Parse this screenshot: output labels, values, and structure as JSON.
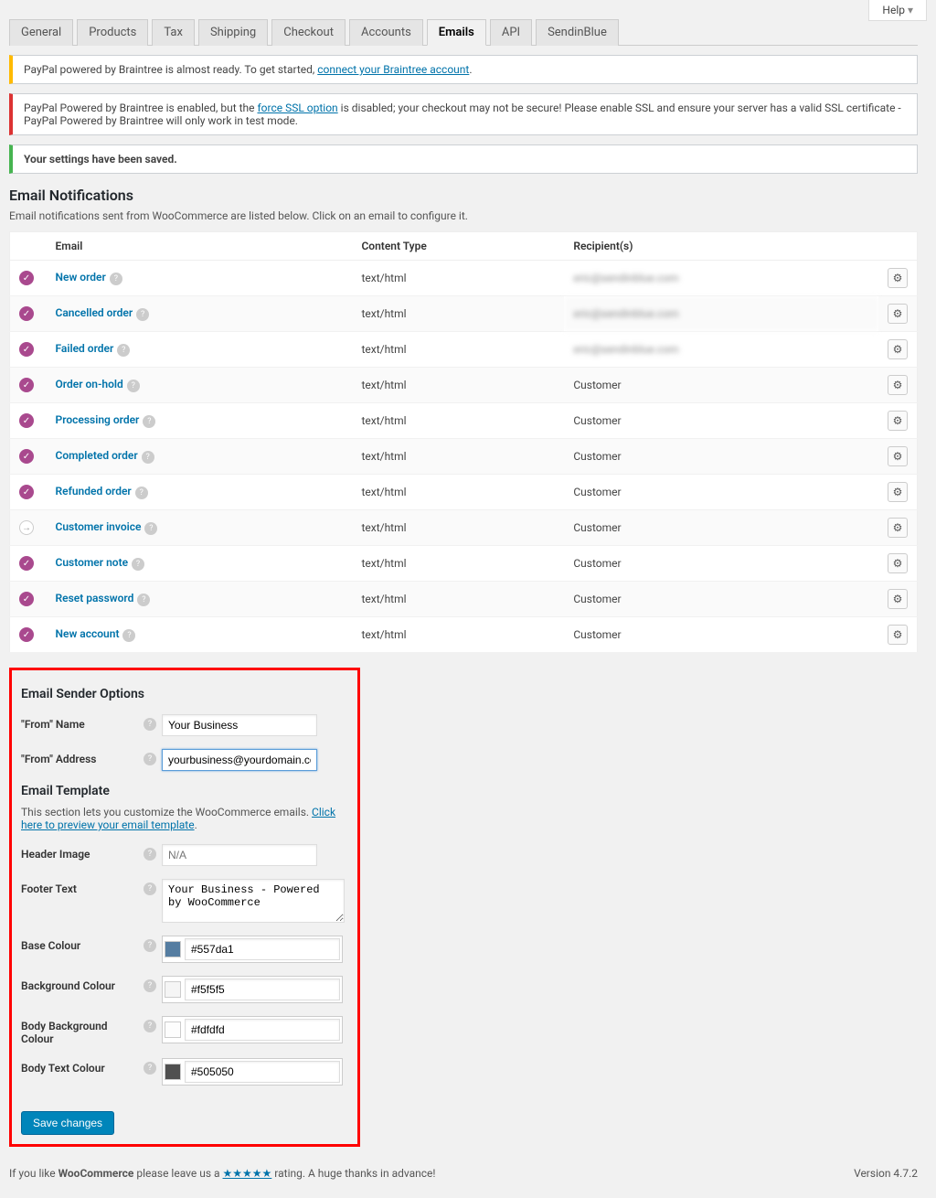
{
  "help_tab": "Help",
  "tabs": [
    "General",
    "Products",
    "Tax",
    "Shipping",
    "Checkout",
    "Accounts",
    "Emails",
    "API",
    "SendinBlue"
  ],
  "active_tab_index": 6,
  "notices": {
    "yellow_prefix": "PayPal powered by Braintree is almost ready. To get started, ",
    "yellow_link": "connect your Braintree account",
    "yellow_suffix": ".",
    "red_prefix": "PayPal Powered by Braintree is enabled, but the ",
    "red_link": "force SSL option",
    "red_suffix": " is disabled; your checkout may not be secure! Please enable SSL and ensure your server has a valid SSL certificate - PayPal Powered by Braintree will only work in test mode.",
    "green": "Your settings have been saved."
  },
  "section_title": "Email Notifications",
  "section_desc": "Email notifications sent from WooCommerce are listed below. Click on an email to configure it.",
  "table": {
    "headers": [
      "",
      "Email",
      "Content Type",
      "Recipient(s)",
      ""
    ],
    "rows": [
      {
        "status": "check",
        "name": "New order",
        "content": "text/html",
        "recipient_blurred": true,
        "recipient": "eric@sendinblue.com"
      },
      {
        "status": "check",
        "name": "Cancelled order",
        "content": "text/html",
        "recipient_blurred": true,
        "recipient": "eric@sendinblue.com"
      },
      {
        "status": "check",
        "name": "Failed order",
        "content": "text/html",
        "recipient_blurred": true,
        "recipient": "eric@sendinblue.com"
      },
      {
        "status": "check",
        "name": "Order on-hold",
        "content": "text/html",
        "recipient": "Customer"
      },
      {
        "status": "check",
        "name": "Processing order",
        "content": "text/html",
        "recipient": "Customer"
      },
      {
        "status": "check",
        "name": "Completed order",
        "content": "text/html",
        "recipient": "Customer"
      },
      {
        "status": "check",
        "name": "Refunded order",
        "content": "text/html",
        "recipient": "Customer"
      },
      {
        "status": "arrow",
        "name": "Customer invoice",
        "content": "text/html",
        "recipient": "Customer"
      },
      {
        "status": "check",
        "name": "Customer note",
        "content": "text/html",
        "recipient": "Customer"
      },
      {
        "status": "check",
        "name": "Reset password",
        "content": "text/html",
        "recipient": "Customer"
      },
      {
        "status": "check",
        "name": "New account",
        "content": "text/html",
        "recipient": "Customer"
      }
    ]
  },
  "sender": {
    "title": "Email Sender Options",
    "from_name_label": "\"From\" Name",
    "from_name_value": "Your Business",
    "from_addr_label": "\"From\" Address",
    "from_addr_value": "yourbusiness@yourdomain.com"
  },
  "template": {
    "title": "Email Template",
    "desc_prefix": "This section lets you customize the WooCommerce emails. ",
    "desc_link": "Click here to preview your email template",
    "desc_suffix": ".",
    "header_image_label": "Header Image",
    "header_image_placeholder": "N/A",
    "footer_text_label": "Footer Text",
    "footer_text_value": "Your Business - Powered by WooCommerce",
    "base_colour_label": "Base Colour",
    "base_colour": "#557da1",
    "bg_colour_label": "Background Colour",
    "bg_colour": "#f5f5f5",
    "body_bg_label": "Body Background Colour",
    "body_bg": "#fdfdfd",
    "body_text_label": "Body Text Colour",
    "body_text": "#505050"
  },
  "save_label": "Save changes",
  "footer": {
    "prefix": "If you like ",
    "strong": "WooCommerce",
    "mid": " please leave us a ",
    "stars": "★★★★★",
    "suffix": " rating. A huge thanks in advance!",
    "version": "Version 4.7.2"
  }
}
